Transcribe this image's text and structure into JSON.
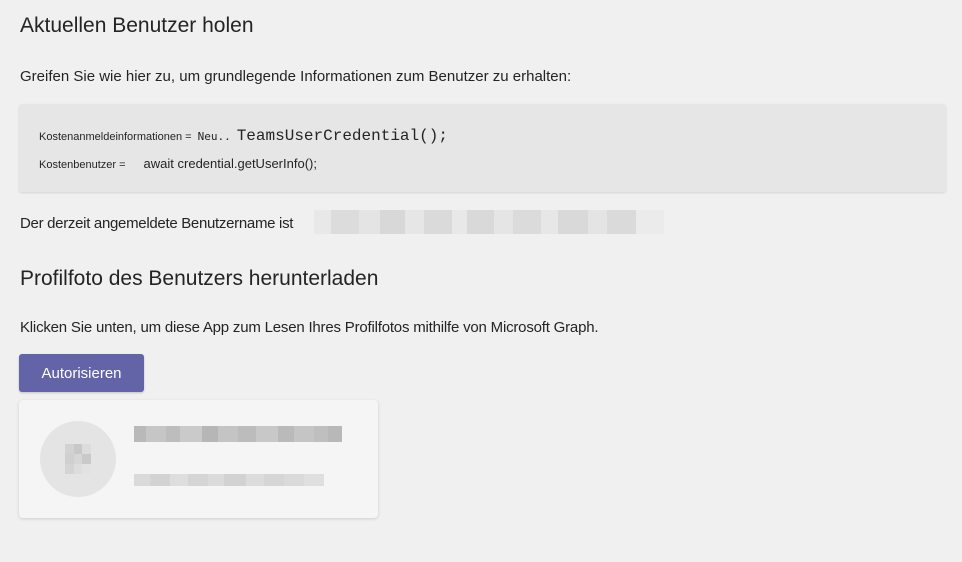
{
  "section_current_user": {
    "title": "Aktuellen Benutzer holen",
    "description": "Greifen Sie wie hier zu, um grundlegende Informationen zum Benutzer zu erhalten:",
    "code": {
      "line1_label": "Kostenanmeldeinformationen =",
      "line1_keyword": "Neu..",
      "line1_code": "TeamsUserCredential();",
      "line2_label": "Kostenbenutzer =",
      "line2_code": "await credential.getUserInfo();"
    },
    "username_text": "Der derzeit angemeldete Benutzername ist"
  },
  "section_photo": {
    "title": "Profilfoto des Benutzers herunterladen",
    "description": "Klicken Sie unten, um diese App zum Lesen Ihres Profilfotos mithilfe von Microsoft Graph.",
    "button_label": "Autorisieren"
  },
  "colors": {
    "background": "#f0f0f0",
    "accent": "#6264a7",
    "code_background": "#e6e6e6",
    "card_background": "#f5f5f5"
  }
}
